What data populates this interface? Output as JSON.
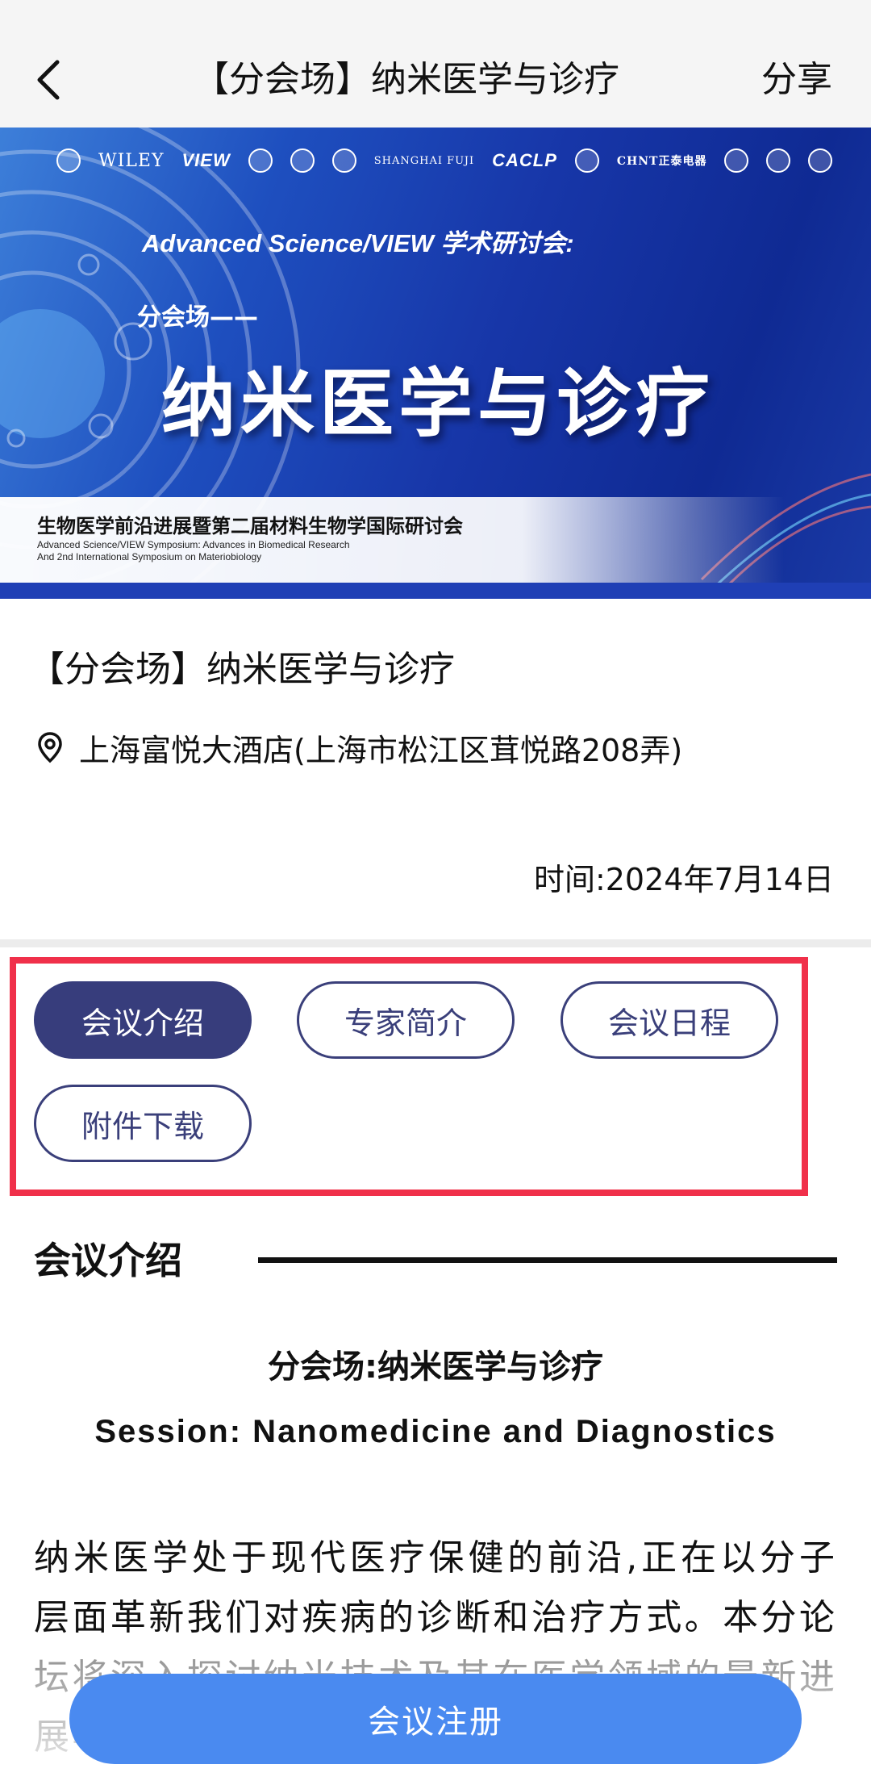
{
  "header": {
    "back_icon": "chevron-left-icon",
    "title": "【分会场】纳米医学与诊疗",
    "share_label": "分享"
  },
  "banner": {
    "logos": [
      "WILEY",
      "VIEW",
      "SHANGHAI FUJI",
      "CACLP",
      "CHNT正泰电器"
    ],
    "subtitle": "Advanced Science/VIEW 学术研讨会:",
    "branch_label": "分会场——",
    "main_title": "纳米医学与诊疗",
    "strip_cn": "生物医学前沿进展暨第二届材料生物学国际研讨会",
    "strip_en_line1": "Advanced Science/VIEW Symposium: Advances in Biomedical Research",
    "strip_en_line2": "And 2nd International Symposium on Materiobiology",
    "colors": {
      "primary": "#1736a8",
      "light": "#3d7fd9"
    }
  },
  "event": {
    "title": "【分会场】纳米医学与诊疗",
    "location_icon": "location-pin-icon",
    "location": "上海富悦大酒店(上海市松江区茸悦路208弄)",
    "time": "时间:2024年7月14日"
  },
  "tabs": [
    {
      "label": "会议介绍",
      "active": true
    },
    {
      "label": "专家简介",
      "active": false
    },
    {
      "label": "会议日程",
      "active": false
    },
    {
      "label": "附件下载",
      "active": false
    }
  ],
  "section": {
    "title": "会议介绍",
    "subtitle_cn": "分会场:纳米医学与诊疗",
    "subtitle_en": "Session: Nanomedicine and Diagnostics",
    "intro": "纳米医学处于现代医疗保健的前沿,正在以分子层面革新我们对疾病的诊断和治疗方式。本分论坛将深入探讨纳米技术及其在医学领域的最新进展与应用,共同探索"
  },
  "register": {
    "label": "会议注册"
  },
  "colors": {
    "tab_active_bg": "#373d7c",
    "tab_border": "#3a3f7a",
    "highlight_frame": "#f0304a",
    "register_btn": "#4a8af0"
  }
}
